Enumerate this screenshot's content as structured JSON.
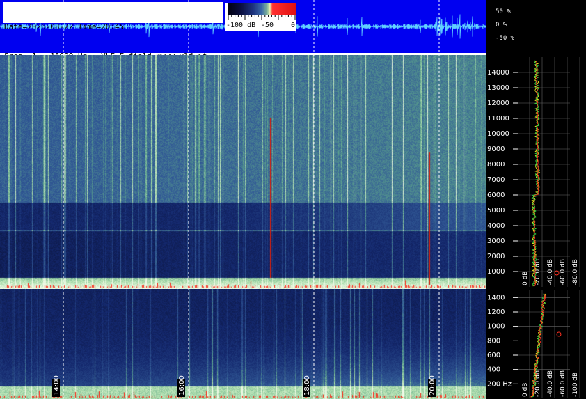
{
  "header": {
    "line1": "Date=2026-08-22 Time=20:45",
    "line2": "Freq= 1...15000 Hz   VLF E-field ©www.vlf.it"
  },
  "colorbar": {
    "ticks": [
      "-100 dB",
      "-50",
      "0"
    ],
    "colors": [
      "#000010",
      "#1e3580",
      "#3b6aa8",
      "#7fb59a",
      "#e8f0b0",
      "#ff3030"
    ]
  },
  "waveform_axis": [
    "50 %",
    "0 %",
    "-50 %"
  ],
  "chart_data": [
    {
      "type": "heatmap",
      "name_hint": "upper spectrogram",
      "y_ticks": [
        1000,
        2000,
        3000,
        4000,
        5000,
        6000,
        7000,
        8000,
        9000,
        10000,
        11000,
        12000,
        13000,
        14000
      ],
      "y_tick_labels": [
        "1000",
        "2000",
        "3000",
        "4000",
        "5000",
        "6000",
        "7000",
        "8000",
        "9000",
        "10000",
        "11000",
        "12000",
        "13000",
        "14000"
      ],
      "ylim": [
        0,
        15000
      ],
      "time_labels": [
        "14:00",
        "16:00",
        "18:00",
        "20:00"
      ],
      "spectrum_x_labels": [
        "0 dB",
        "-20.0 dB",
        "-40.0 dB",
        "-60.0 dB",
        "-80.0 dB"
      ]
    },
    {
      "type": "heatmap",
      "name_hint": "lower spectrogram",
      "y_ticks": [
        200,
        400,
        600,
        800,
        1000,
        1200,
        1400
      ],
      "y_tick_labels": [
        "200 Hz",
        "400",
        "600",
        "800",
        "1000",
        "1200",
        "1400"
      ],
      "ylim": [
        0,
        1500
      ],
      "time_labels": [
        "14:00",
        "16:00",
        "18:00",
        "20:00"
      ],
      "spectrum_x_labels": [
        "0 dB",
        "-20.0 dB",
        "-40.0 dB",
        "-60.0 dB",
        "-100 dB"
      ]
    }
  ]
}
